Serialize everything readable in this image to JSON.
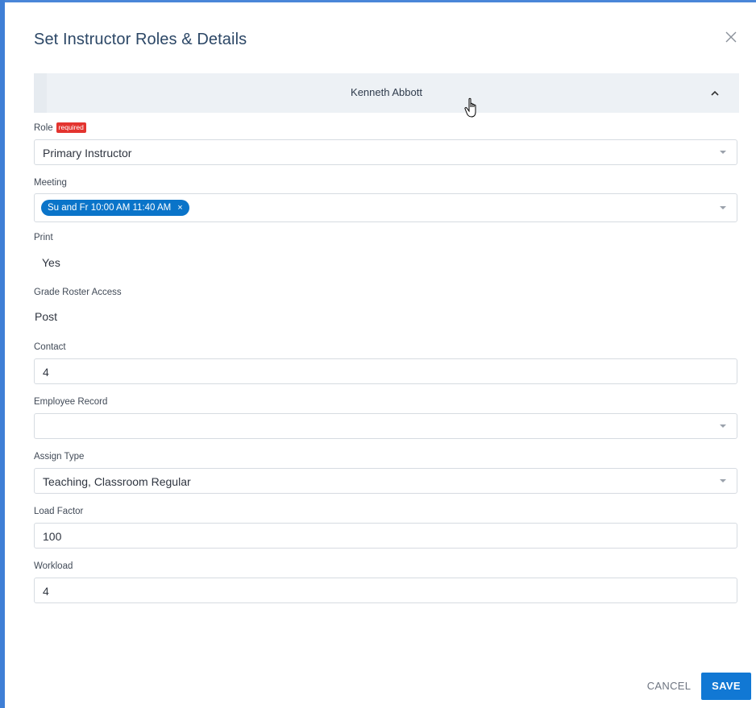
{
  "dialog": {
    "title": "Set Instructor Roles & Details",
    "close_icon": "close-icon"
  },
  "instructor": {
    "name": "Kenneth Abbott",
    "toggle_icon": "chevron-up-icon"
  },
  "fields": {
    "role": {
      "label": "Role",
      "required_badge": "required",
      "value": "Primary Instructor"
    },
    "meeting": {
      "label": "Meeting",
      "chip": "Su and Fr 10:00 AM 11:40 AM",
      "chip_remove": "×"
    },
    "print": {
      "label": "Print",
      "value": "Yes"
    },
    "grade_roster_access": {
      "label": "Grade Roster Access",
      "value": "Post"
    },
    "contact": {
      "label": "Contact",
      "value": "4"
    },
    "employee_record": {
      "label": "Employee Record",
      "value": ""
    },
    "assign_type": {
      "label": "Assign Type",
      "value": "Teaching, Classroom Regular"
    },
    "load_factor": {
      "label": "Load Factor",
      "value": "100"
    },
    "workload": {
      "label": "Workload",
      "value": "4"
    }
  },
  "actions": {
    "cancel_label": "CANCEL",
    "save_label": "SAVE"
  },
  "colors": {
    "primary": "#1178d4",
    "chip": "#0a74c9",
    "required": "#e3342f",
    "title": "#2c4766"
  }
}
